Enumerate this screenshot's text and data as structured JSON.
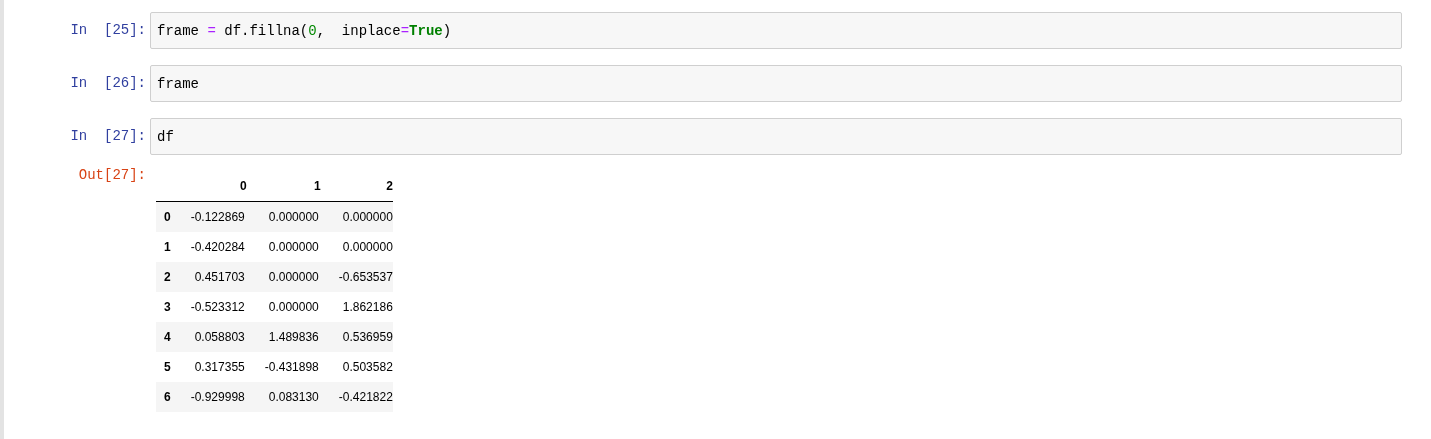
{
  "cells": [
    {
      "prompt": "In  [25]:",
      "code": [
        {
          "kind": "name",
          "text": "frame "
        },
        {
          "kind": "operator",
          "text": "="
        },
        {
          "kind": "name",
          "text": " df.fillna("
        },
        {
          "kind": "number",
          "text": "0"
        },
        {
          "kind": "name",
          "text": ",  inplace"
        },
        {
          "kind": "operator",
          "text": "="
        },
        {
          "kind": "keyword",
          "text": "True"
        },
        {
          "kind": "name",
          "text": ")"
        }
      ]
    },
    {
      "prompt": "In  [26]:",
      "code": [
        {
          "kind": "name",
          "text": "frame"
        }
      ]
    },
    {
      "prompt": "In  [27]:",
      "code": [
        {
          "kind": "name",
          "text": "df"
        }
      ],
      "output": {
        "prompt": "Out[27]:",
        "table": {
          "columns": [
            "",
            "0",
            "1",
            "2"
          ],
          "rows": [
            [
              "0",
              "-0.122869",
              "0.000000",
              "0.000000"
            ],
            [
              "1",
              "-0.420284",
              "0.000000",
              "0.000000"
            ],
            [
              "2",
              "0.451703",
              "0.000000",
              "-0.653537"
            ],
            [
              "3",
              "-0.523312",
              "0.000000",
              "1.862186"
            ],
            [
              "4",
              "0.058803",
              "1.489836",
              "0.536959"
            ],
            [
              "5",
              "0.317355",
              "-0.431898",
              "0.503582"
            ],
            [
              "6",
              "-0.929998",
              "0.083130",
              "-0.421822"
            ]
          ]
        }
      }
    }
  ]
}
